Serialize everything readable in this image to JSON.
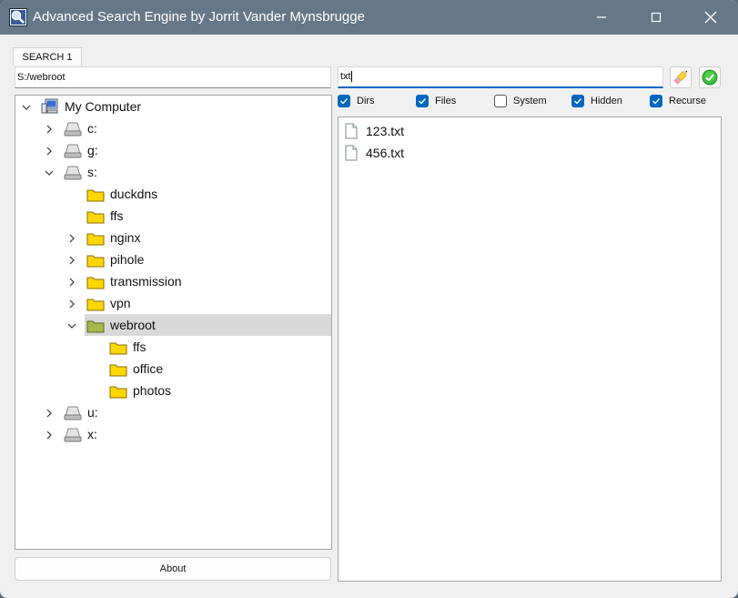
{
  "window": {
    "title": "Advanced Search Engine by Jorrit Vander Mynsbrugge",
    "titlebar_color": "#667888",
    "controls": [
      "minimize-icon",
      "maximize-icon",
      "close-icon"
    ]
  },
  "tabs": [
    {
      "label": "SEARCH 1",
      "active": true
    }
  ],
  "path": {
    "value": "S:/webroot"
  },
  "search": {
    "value": "txt"
  },
  "buttons": {
    "clear_icon": "pencil-eraser-icon",
    "go_icon": "green-check-icon",
    "about_label": "About"
  },
  "filters": [
    {
      "label": "Dirs",
      "checked": true
    },
    {
      "label": "Files",
      "checked": true
    },
    {
      "label": "System",
      "checked": false
    },
    {
      "label": "Hidden",
      "checked": true
    },
    {
      "label": "Recurse",
      "checked": true
    }
  ],
  "tree": {
    "root": "My Computer",
    "drives": [
      "c:",
      "g:",
      "s:",
      "u:",
      "x:"
    ],
    "s_folders": [
      "duckdns",
      "ffs",
      "nginx",
      "pihole",
      "transmission",
      "vpn",
      "webroot"
    ],
    "webroot_folders": [
      "ffs",
      "office",
      "photos"
    ],
    "selected": "webroot"
  },
  "results": [
    {
      "name": "123.txt"
    },
    {
      "name": "456.txt"
    }
  ],
  "colors": {
    "accent": "#0067c0",
    "selection": "#d9d9d9",
    "folder": "#ffd700"
  }
}
